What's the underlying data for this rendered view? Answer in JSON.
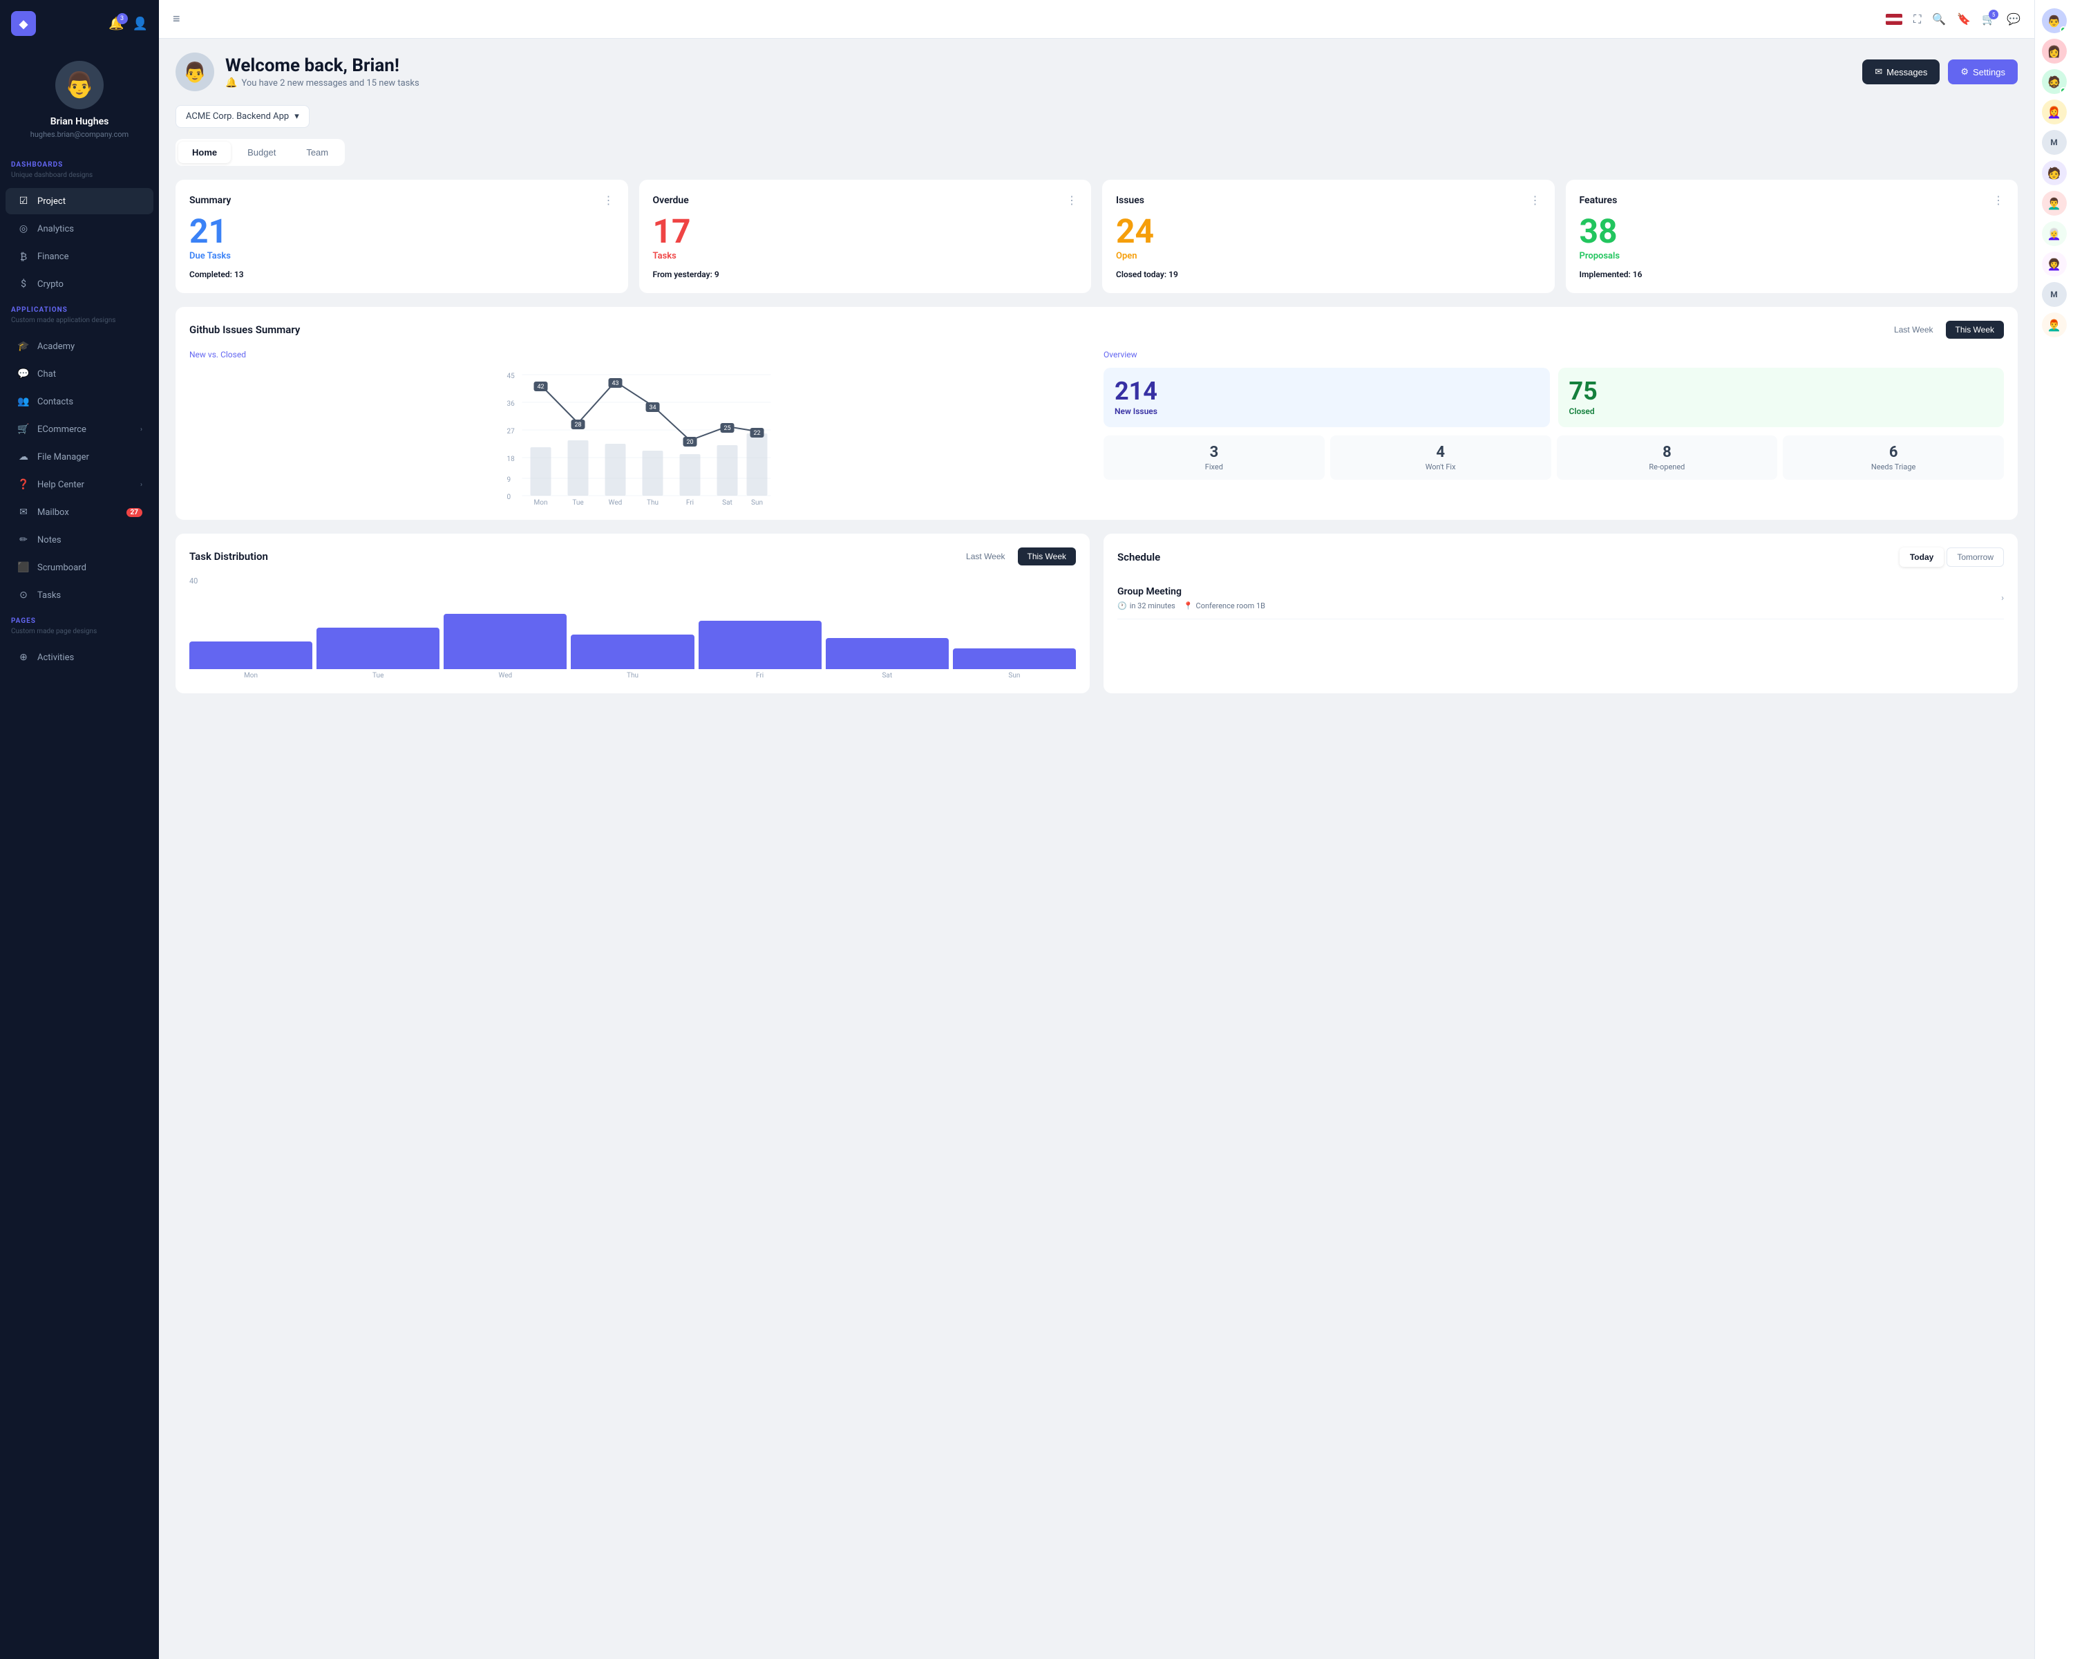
{
  "sidebar": {
    "logo": "◆",
    "notification_count": "3",
    "user": {
      "name": "Brian Hughes",
      "email": "hughes.brian@company.com",
      "avatar": "👨"
    },
    "sections": [
      {
        "label": "DASHBOARDS",
        "sublabel": "Unique dashboard designs",
        "items": [
          {
            "id": "project",
            "icon": "☑",
            "label": "Project",
            "active": true
          },
          {
            "id": "analytics",
            "icon": "◎",
            "label": "Analytics"
          },
          {
            "id": "finance",
            "icon": "₿",
            "label": "Finance"
          },
          {
            "id": "crypto",
            "icon": "$",
            "label": "Crypto"
          }
        ]
      },
      {
        "label": "APPLICATIONS",
        "sublabel": "Custom made application designs",
        "items": [
          {
            "id": "academy",
            "icon": "🎓",
            "label": "Academy"
          },
          {
            "id": "chat",
            "icon": "💬",
            "label": "Chat"
          },
          {
            "id": "contacts",
            "icon": "👥",
            "label": "Contacts"
          },
          {
            "id": "ecommerce",
            "icon": "🛒",
            "label": "ECommerce",
            "arrow": true
          },
          {
            "id": "filemanager",
            "icon": "☁",
            "label": "File Manager"
          },
          {
            "id": "helpcenter",
            "icon": "❓",
            "label": "Help Center",
            "arrow": true
          },
          {
            "id": "mailbox",
            "icon": "✉",
            "label": "Mailbox",
            "badge": "27"
          },
          {
            "id": "notes",
            "icon": "✏",
            "label": "Notes"
          },
          {
            "id": "scrumboard",
            "icon": "⬛",
            "label": "Scrumboard"
          },
          {
            "id": "tasks",
            "icon": "⊙",
            "label": "Tasks"
          }
        ]
      },
      {
        "label": "PAGES",
        "sublabel": "Custom made page designs",
        "items": [
          {
            "id": "activities",
            "icon": "⊕",
            "label": "Activities"
          }
        ]
      }
    ]
  },
  "topbar": {
    "cart_badge": "5"
  },
  "welcome": {
    "greeting": "Welcome back, Brian!",
    "subtitle": "You have 2 new messages and 15 new tasks",
    "messages_btn": "Messages",
    "settings_btn": "Settings"
  },
  "project_selector": {
    "label": "ACME Corp. Backend App"
  },
  "tabs": [
    {
      "id": "home",
      "label": "Home",
      "active": true
    },
    {
      "id": "budget",
      "label": "Budget"
    },
    {
      "id": "team",
      "label": "Team"
    }
  ],
  "summary_cards": [
    {
      "title": "Summary",
      "number": "21",
      "number_color": "blue",
      "label": "Due Tasks",
      "label_color": "blue",
      "footer_key": "Completed:",
      "footer_val": "13"
    },
    {
      "title": "Overdue",
      "number": "17",
      "number_color": "red",
      "label": "Tasks",
      "label_color": "red",
      "footer_key": "From yesterday:",
      "footer_val": "9"
    },
    {
      "title": "Issues",
      "number": "24",
      "number_color": "orange",
      "label": "Open",
      "label_color": "orange",
      "footer_key": "Closed today:",
      "footer_val": "19"
    },
    {
      "title": "Features",
      "number": "38",
      "number_color": "green",
      "label": "Proposals",
      "label_color": "green",
      "footer_key": "Implemented:",
      "footer_val": "16"
    }
  ],
  "github": {
    "title": "Github Issues Summary",
    "last_week": "Last Week",
    "this_week": "This Week",
    "chart_subtitle": "New vs. Closed",
    "overview_title": "Overview",
    "chart_data": {
      "days": [
        "Mon",
        "Tue",
        "Wed",
        "Thu",
        "Fri",
        "Sat",
        "Sun"
      ],
      "line_values": [
        42,
        28,
        43,
        34,
        20,
        25,
        22
      ],
      "bar_heights": [
        70,
        60,
        65,
        55,
        50,
        60,
        80
      ]
    },
    "new_issues": "214",
    "new_issues_label": "New Issues",
    "closed": "75",
    "closed_label": "Closed",
    "mini_stats": [
      {
        "num": "3",
        "label": "Fixed"
      },
      {
        "num": "4",
        "label": "Won't Fix"
      },
      {
        "num": "8",
        "label": "Re-opened"
      },
      {
        "num": "6",
        "label": "Needs Triage"
      }
    ]
  },
  "task_distribution": {
    "title": "Task Distribution",
    "last_week": "Last Week",
    "this_week": "This Week",
    "bars": [
      {
        "label": "Mon",
        "height": 40
      },
      {
        "label": "Tue",
        "height": 60
      },
      {
        "label": "Wed",
        "height": 80
      },
      {
        "label": "Thu",
        "height": 50
      },
      {
        "label": "Fri",
        "height": 70
      },
      {
        "label": "Sat",
        "height": 45
      },
      {
        "label": "Sun",
        "height": 30
      }
    ],
    "max_label": "40"
  },
  "schedule": {
    "title": "Schedule",
    "today": "Today",
    "tomorrow": "Tomorrow",
    "meetings": [
      {
        "title": "Group Meeting",
        "time": "in 32 minutes",
        "location": "Conference room 1B"
      }
    ]
  },
  "right_panel": {
    "avatars": [
      "👨",
      "👩",
      "🧔",
      "👩‍🦰",
      "M",
      "🧑",
      "👨‍🦱",
      "👩‍🦳",
      "👩‍🦱",
      "M",
      "👨‍🦰"
    ]
  }
}
